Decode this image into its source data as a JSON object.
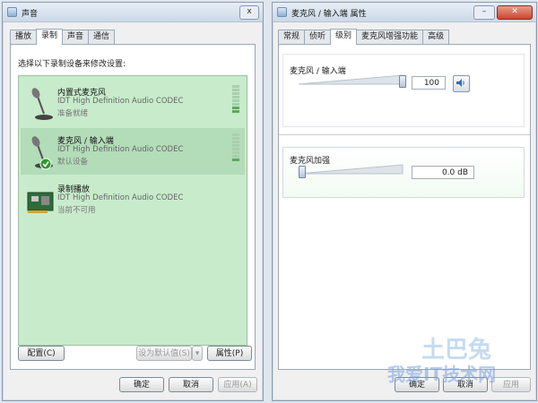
{
  "left_window": {
    "title": "声音",
    "close_label": "x",
    "tabs": [
      {
        "label": "播放"
      },
      {
        "label": "录制"
      },
      {
        "label": "声音"
      },
      {
        "label": "通信"
      }
    ],
    "active_tab": "录制",
    "instruction": "选择以下录制设备来修改设置:",
    "devices": [
      {
        "name": "内置式麦克风",
        "driver": "IDT High Definition Audio CODEC",
        "status": "准备就绪",
        "icon": "microphone-icon",
        "meter_level": 0.2
      },
      {
        "name": "麦克风 / 输入端",
        "driver": "IDT High Definition Audio CODEC",
        "status": "默认设备",
        "icon": "microphone-default-icon",
        "meter_level": 0.1,
        "selected": true
      },
      {
        "name": "录制播放",
        "driver": "IDT High Definition Audio CODEC",
        "status": "当前不可用",
        "icon": "sound-card-icon"
      }
    ],
    "configure_label": "配置(C)",
    "set_default_label": "设为默认值(S)",
    "properties_label": "属性(P)",
    "ok_label": "确定",
    "cancel_label": "取消",
    "apply_label": "应用(A)"
  },
  "right_window": {
    "title": "麦克风 / 输入端 属性",
    "tabs": [
      {
        "label": "常规"
      },
      {
        "label": "侦听"
      },
      {
        "label": "级别"
      },
      {
        "label": "麦克风增强功能"
      },
      {
        "label": "高级"
      }
    ],
    "active_tab": "级别",
    "mic_label": "麦克风 / 输入端",
    "mic_value": "100",
    "mic_level": 1.0,
    "boost_label": "麦克风加强",
    "boost_value": "0.0 dB",
    "boost_level": 0.0,
    "ok_label": "确定",
    "cancel_label": "取消",
    "apply_label": "应用"
  },
  "watermark": {
    "text_top": "土巴兔",
    "text_bottom": "我爱IT技术网"
  },
  "colors": {
    "device_list_bg": "#c8ebcb",
    "selected_row": "#b3dcb8",
    "meter_on": "#5aa85f",
    "default_check": "#2e9a2e"
  }
}
